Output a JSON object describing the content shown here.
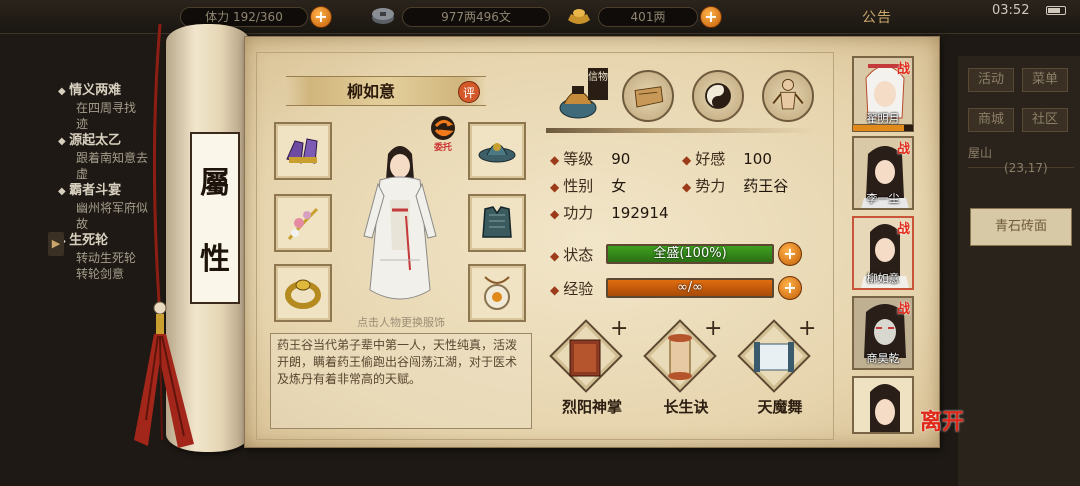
{
  "topbar": {
    "stamina_text": "体力 192/360",
    "copper_text": "977两496文",
    "silver_text": "401两",
    "plus_label": "+",
    "notice_label": "公告",
    "clock": "03:52",
    "battery_level": 0.6
  },
  "quests": [
    {
      "title": "情义两难",
      "desc": "在四周寻找",
      "desc2": "迹"
    },
    {
      "title": "源起太乙",
      "desc": "跟着南知意去",
      "desc2": "虚"
    },
    {
      "title": "霸者斗宴",
      "desc": "幽州将军府似",
      "desc2": "故"
    },
    {
      "title": "生死轮",
      "desc": "转动生死轮",
      "desc2": "转轮剑意"
    }
  ],
  "scroll": {
    "label_top": "屬",
    "label_bottom": "性"
  },
  "character": {
    "name": "柳如意",
    "rate_label": "评",
    "delegate_label": "委托",
    "outfit_hint": "点击人物更换服饰",
    "bio": "药王谷当代弟子辈中第一人，天性纯真，活泼开朗，瞒着药王偷跑出谷闯荡江湖，对于医术及炼丹有着非常高的天赋。"
  },
  "top_icons": {
    "xinwu_label": "信物"
  },
  "stats": {
    "level": {
      "label": "等级",
      "value": "90"
    },
    "affection": {
      "label": "好感",
      "value": "100"
    },
    "gender": {
      "label": "性别",
      "value": "女"
    },
    "faction": {
      "label": "势力",
      "value": "药王谷"
    },
    "power": {
      "label": "功力",
      "value": "192914"
    }
  },
  "bars": {
    "status": {
      "label": "状态",
      "text": "全盛(100%)",
      "fill": 1.0,
      "color": "#3fa020"
    },
    "exp": {
      "label": "经验",
      "text": "∞/∞",
      "fill": 1.0,
      "color": "#e06d10"
    }
  },
  "skills": [
    {
      "name": "烈阳神掌",
      "plus": "+"
    },
    {
      "name": "长生诀",
      "plus": "+"
    },
    {
      "name": "天魔舞",
      "plus": "+"
    }
  ],
  "roster": [
    {
      "name": "翟明月",
      "tag": "战"
    },
    {
      "name": "李一尘",
      "tag": "战"
    },
    {
      "name": "柳如意",
      "tag": "战"
    },
    {
      "name": "商昊乾",
      "tag": "战"
    },
    {
      "name": "",
      "tag": ""
    }
  ],
  "roster_affection_fill": 0.85,
  "depart_label": "离开",
  "right_panel": {
    "buttons": [
      "活动",
      "菜单",
      "商城",
      "社区"
    ],
    "location": "屋山",
    "coords": "(23,17)",
    "item_slot": "青石砖面"
  }
}
